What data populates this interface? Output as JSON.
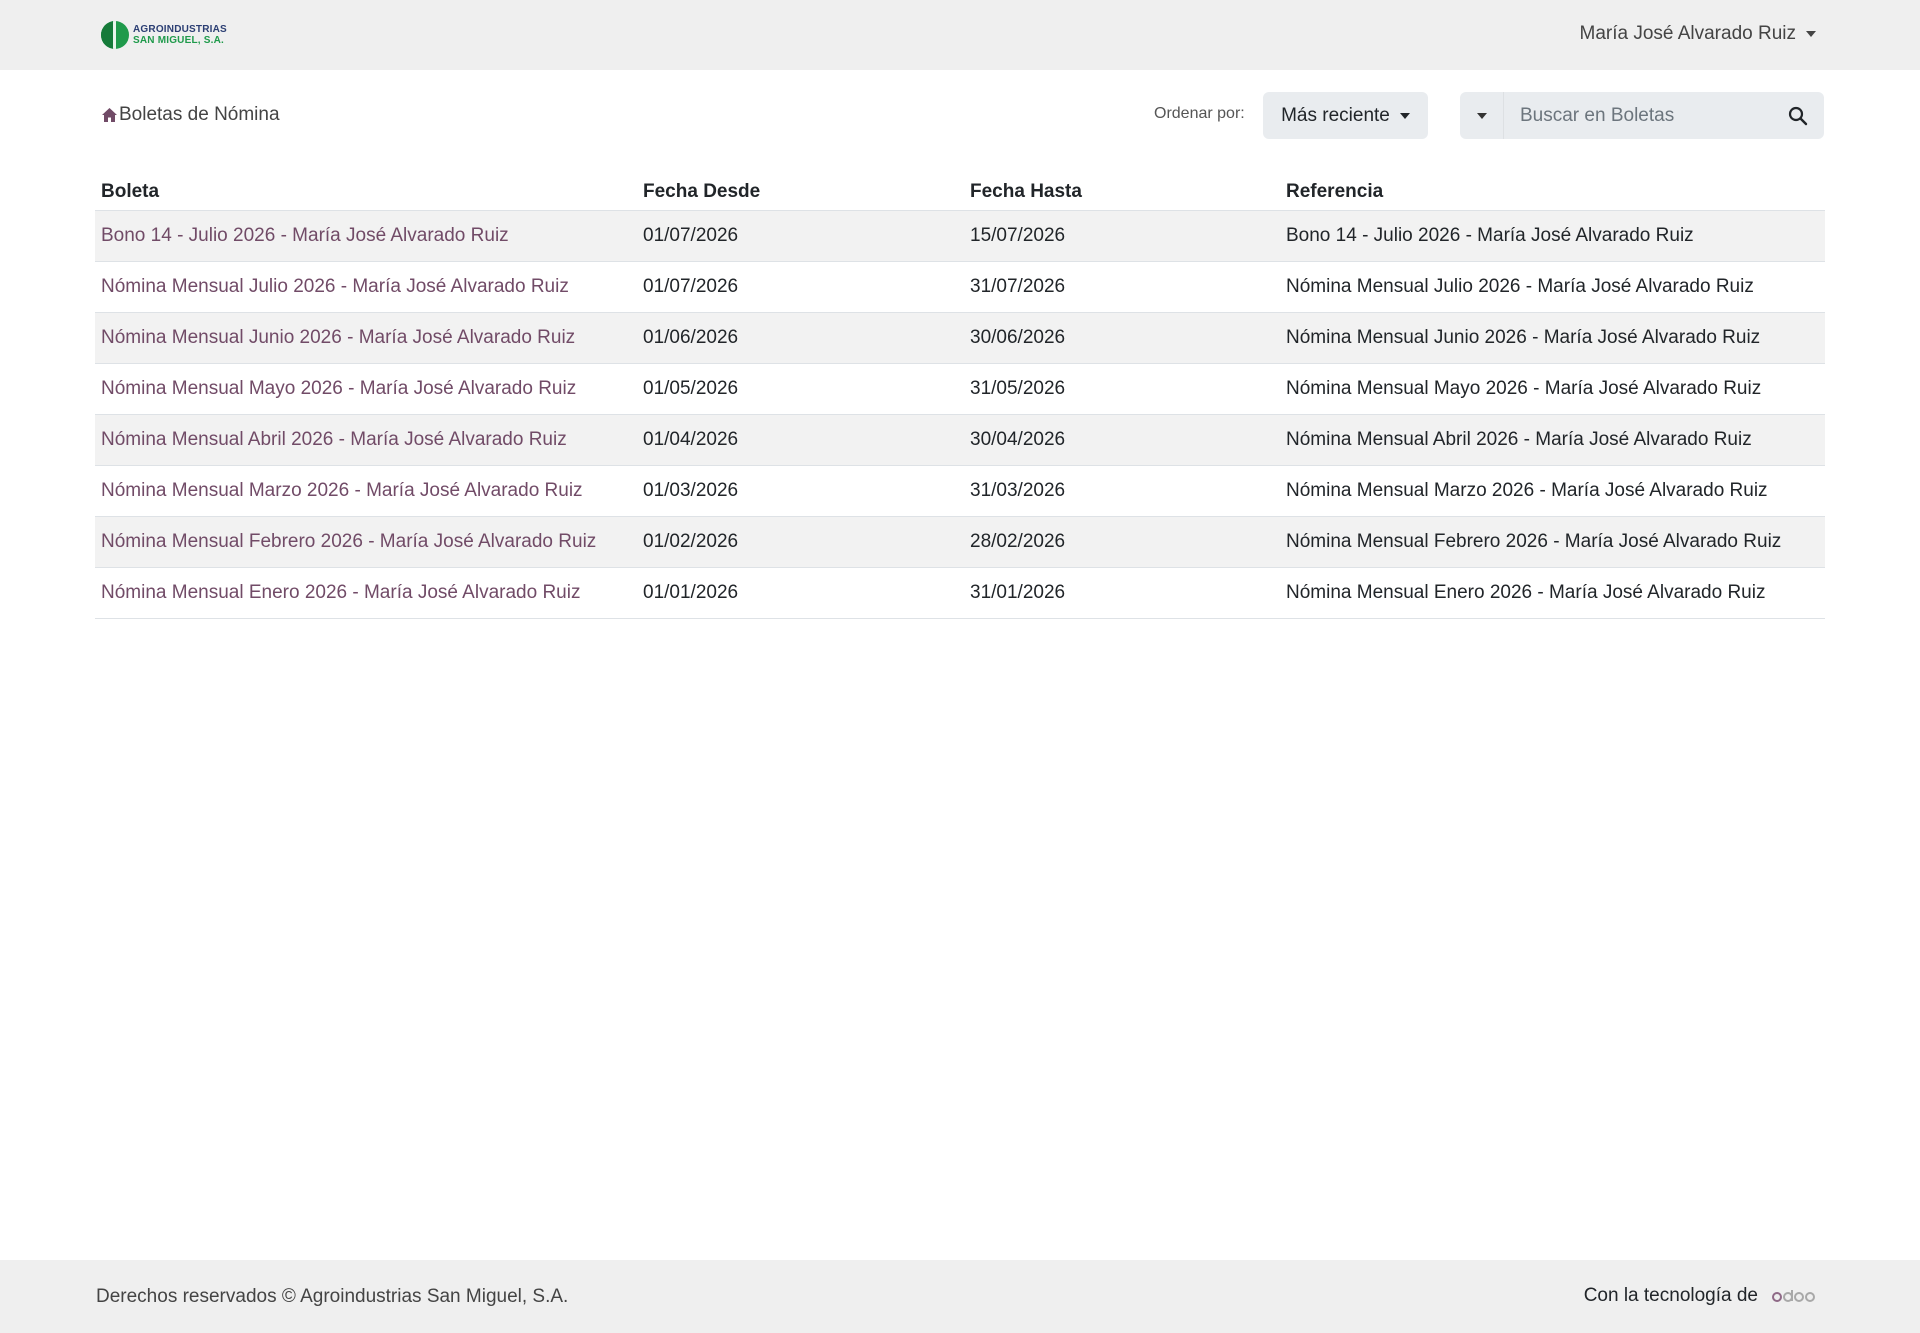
{
  "navbar": {
    "logo_line1": "AGROINDUSTRIAS",
    "logo_line2": "SAN MIGUEL, S.A.",
    "user_name": "María José Alvarado Ruiz"
  },
  "toolbar": {
    "breadcrumb": "Boletas de Nómina",
    "sort_label": "Ordenar por:",
    "sort_value": "Más reciente",
    "search_placeholder": "Buscar en Boletas"
  },
  "table": {
    "headers": [
      "Boleta",
      "Fecha Desde",
      "Fecha Hasta",
      "Referencia"
    ],
    "rows": [
      {
        "boleta": "Bono 14 - Julio 2026 - María José Alvarado Ruiz",
        "desde": "01/07/2026",
        "hasta": "15/07/2026",
        "referencia": "Bono 14 - Julio 2026 - María José Alvarado Ruiz"
      },
      {
        "boleta": "Nómina Mensual Julio 2026 - María José Alvarado Ruiz",
        "desde": "01/07/2026",
        "hasta": "31/07/2026",
        "referencia": "Nómina Mensual Julio 2026 - María José Alvarado Ruiz"
      },
      {
        "boleta": "Nómina Mensual Junio 2026 - María José Alvarado Ruiz",
        "desde": "01/06/2026",
        "hasta": "30/06/2026",
        "referencia": "Nómina Mensual Junio 2026 - María José Alvarado Ruiz"
      },
      {
        "boleta": "Nómina Mensual Mayo 2026 - María José Alvarado Ruiz",
        "desde": "01/05/2026",
        "hasta": "31/05/2026",
        "referencia": "Nómina Mensual Mayo 2026 - María José Alvarado Ruiz"
      },
      {
        "boleta": "Nómina Mensual Abril 2026 - María José Alvarado Ruiz",
        "desde": "01/04/2026",
        "hasta": "30/04/2026",
        "referencia": "Nómina Mensual Abril 2026 - María José Alvarado Ruiz"
      },
      {
        "boleta": "Nómina Mensual Marzo 2026 - María José Alvarado Ruiz",
        "desde": "01/03/2026",
        "hasta": "31/03/2026",
        "referencia": "Nómina Mensual Marzo 2026 - María José Alvarado Ruiz"
      },
      {
        "boleta": "Nómina Mensual Febrero 2026 - María José Alvarado Ruiz",
        "desde": "01/02/2026",
        "hasta": "28/02/2026",
        "referencia": "Nómina Mensual Febrero 2026 - María José Alvarado Ruiz"
      },
      {
        "boleta": "Nómina Mensual Enero 2026 - María José Alvarado Ruiz",
        "desde": "01/01/2026",
        "hasta": "31/01/2026",
        "referencia": "Nómina Mensual Enero 2026 - María José Alvarado Ruiz"
      }
    ]
  },
  "footer": {
    "copyright": "Derechos reservados © Agroindustrias San Miguel, S.A.",
    "powered_by": "Con la tecnología de",
    "powered_logo": "odoo"
  },
  "icons": {
    "home": "home-icon",
    "search": "search-icon",
    "caret": "caret-down-icon"
  },
  "colors": {
    "link": "#714b67",
    "navbar_bg": "#efefef",
    "stripe_bg": "#f2f2f2",
    "logo_green": "#1f9a4b",
    "logo_blue": "#2b3e73"
  }
}
